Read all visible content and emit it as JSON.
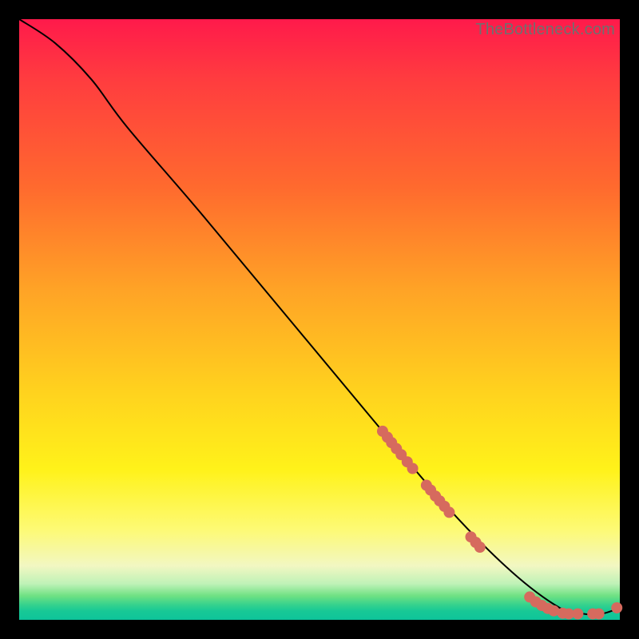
{
  "watermark": "TheBottleneck.com",
  "chart_data": {
    "type": "line",
    "title": "",
    "xlabel": "",
    "ylabel": "",
    "xlim": [
      0,
      100
    ],
    "ylim": [
      0,
      100
    ],
    "grid": false,
    "legend": false,
    "curve": {
      "x": [
        0,
        6,
        12,
        18,
        30,
        45,
        60,
        72,
        82,
        90,
        94,
        97,
        100
      ],
      "y": [
        100,
        96,
        90,
        82,
        68,
        50,
        32,
        18,
        8,
        2,
        1,
        1,
        2
      ]
    },
    "points": {
      "color": "#d66a5e",
      "x": [
        60.5,
        61.3,
        62.0,
        62.8,
        63.6,
        64.6,
        65.5,
        67.8,
        68.5,
        69.3,
        70.0,
        70.8,
        71.6,
        75.2,
        76.0,
        76.7,
        85.0,
        86.0,
        87.0,
        88.0,
        89.0,
        90.5,
        91.5,
        93.0,
        95.5,
        96.5,
        99.5
      ],
      "y": [
        31.4,
        30.4,
        29.5,
        28.5,
        27.5,
        26.3,
        25.2,
        22.4,
        21.6,
        20.6,
        19.8,
        18.9,
        17.9,
        13.8,
        12.9,
        12.1,
        3.8,
        3.0,
        2.4,
        1.9,
        1.5,
        1.1,
        1.0,
        1.0,
        1.0,
        1.0,
        2.0
      ]
    }
  }
}
